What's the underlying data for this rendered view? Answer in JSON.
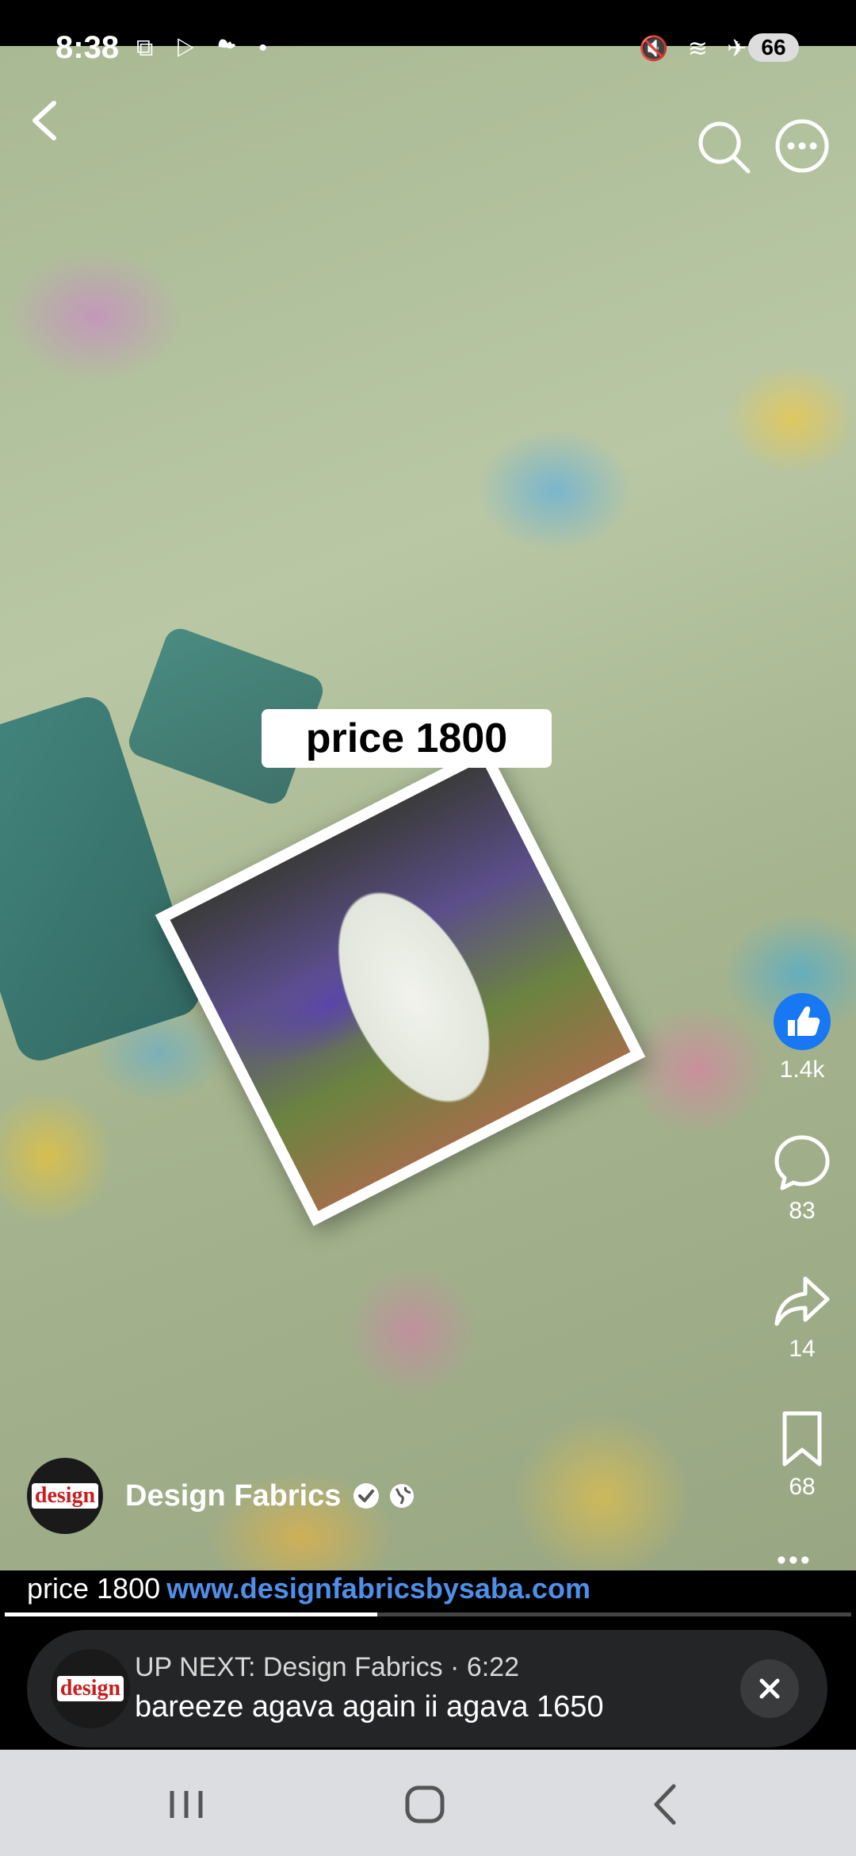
{
  "status_bar": {
    "time": "8:38",
    "left_icons": "⧉ ▷ ☁ •",
    "right_icons": "🔇 ≋ ✈",
    "battery": "66"
  },
  "video": {
    "overlay_text": "price 1800"
  },
  "actions": {
    "like_count": "1.4k",
    "comment_count": "83",
    "share_count": "14",
    "save_count": "68"
  },
  "author": {
    "name": "Design Fabrics",
    "avatar_text": "design"
  },
  "caption": {
    "text": "price 1800",
    "link": "www.designfabricsbysaba.com"
  },
  "progress": {
    "fraction": 0.44
  },
  "up_next": {
    "title": "UP NEXT: Design Fabrics · 6:22",
    "subtitle": "bareeze agava again ii agava 1650"
  },
  "colors": {
    "accent_blue": "#1877f2",
    "link_blue": "#4e8fe8"
  }
}
